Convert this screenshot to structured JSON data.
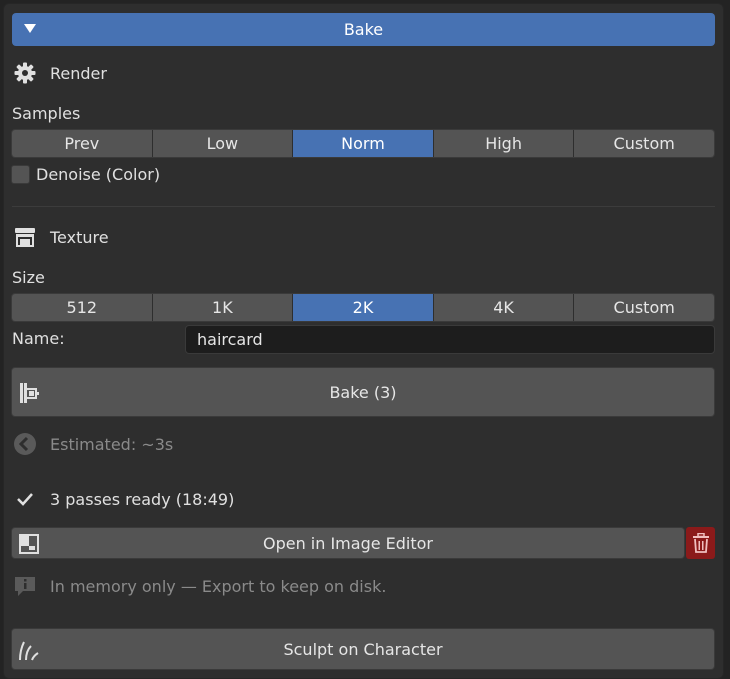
{
  "header": {
    "title": "Bake"
  },
  "render": {
    "title": "Render",
    "samples_label": "Samples",
    "samples_options": [
      "Prev",
      "Low",
      "Norm",
      "High",
      "Custom"
    ],
    "samples_selected": "Norm",
    "denoise_label": "Denoise (Color)",
    "denoise_checked": false
  },
  "texture": {
    "title": "Texture",
    "size_label": "Size",
    "size_options": [
      "512",
      "1K",
      "2K",
      "4K",
      "Custom"
    ],
    "size_selected": "2K",
    "name_label": "Name:",
    "name_value": "haircard"
  },
  "bake_button": {
    "label": "Bake  (3)"
  },
  "estimate": {
    "text": "Estimated: ~3s"
  },
  "status": {
    "text": "3 passes ready  (18:49)"
  },
  "open_editor": {
    "label": "Open in Image Editor"
  },
  "memory_note": {
    "text": "In memory only — Export to keep on disk."
  },
  "sculpt_button": {
    "label": "Sculpt on Character"
  },
  "colors": {
    "accent": "#4772b3",
    "danger": "#8b1a1a",
    "panel": "#2e2e2e",
    "button": "#545454"
  },
  "icons": [
    "triangle-down-icon",
    "gear-icon",
    "texture-icon",
    "bake-icon",
    "clock-icon",
    "check-icon",
    "image-icon",
    "trash-icon",
    "info-icon",
    "sculpt-icon"
  ]
}
